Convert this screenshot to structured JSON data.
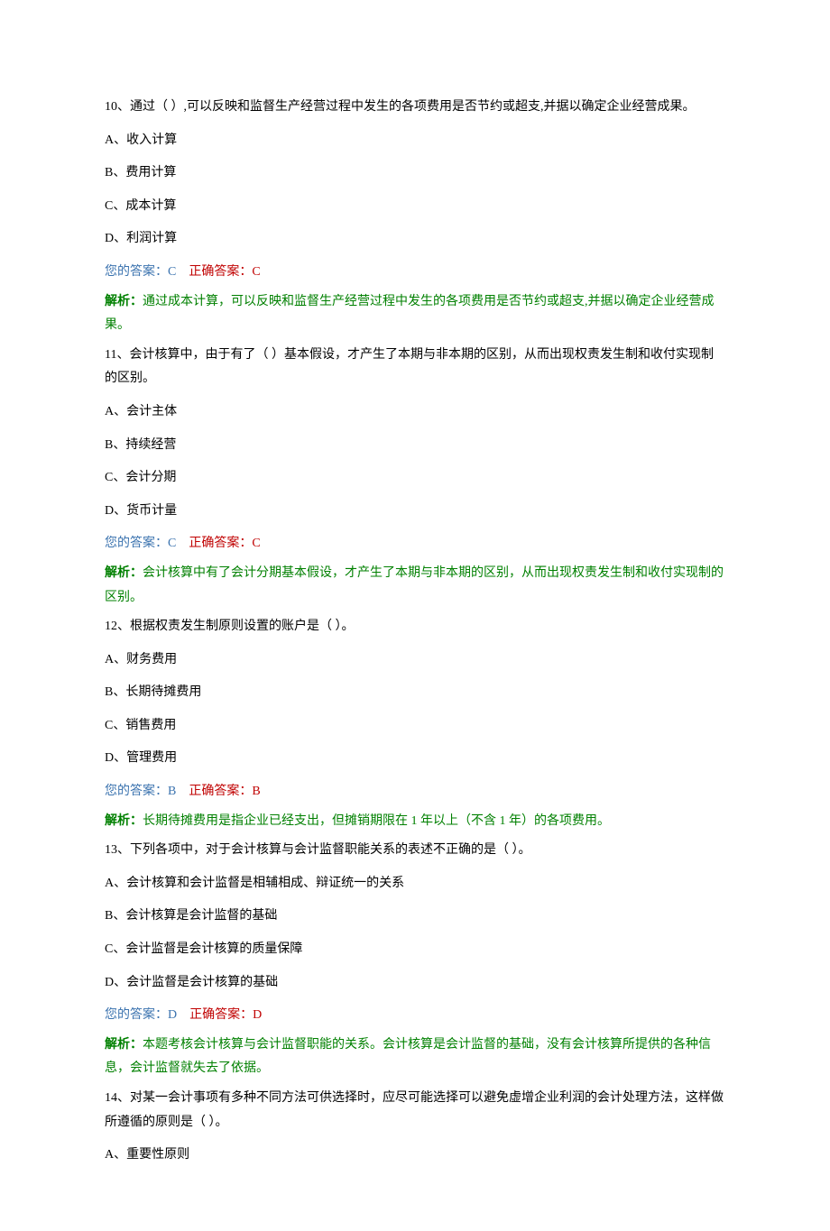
{
  "labels": {
    "your_answer_prefix": "您的答案：",
    "correct_answer_prefix": "正确答案：",
    "analysis_prefix": "解析："
  },
  "questions": [
    {
      "stem": "10、通过（  ）,可以反映和监督生产经营过程中发生的各项费用是否节约或超支,并据以确定企业经营成果。",
      "options": [
        "A、收入计算",
        "B、费用计算",
        "C、成本计算",
        "D、利润计算"
      ],
      "your_answer": "C",
      "correct_answer": "C",
      "analysis": "通过成本计算，可以反映和监督生产经营过程中发生的各项费用是否节约或超支,并据以确定企业经营成果。"
    },
    {
      "stem": "11、会计核算中，由于有了（  ）基本假设，才产生了本期与非本期的区别，从而出现权责发生制和收付实现制的区别。",
      "options": [
        "A、会计主体",
        "B、持续经营",
        "C、会计分期",
        "D、货币计量"
      ],
      "your_answer": "C",
      "correct_answer": "C",
      "analysis": "会计核算中有了会计分期基本假设，才产生了本期与非本期的区别，从而出现权责发生制和收付实现制的区别。"
    },
    {
      "stem": "12、根据权责发生制原则设置的账户是（  ）。",
      "options": [
        "A、财务费用",
        "B、长期待摊费用",
        "C、销售费用",
        "D、管理费用"
      ],
      "your_answer": "B",
      "correct_answer": "B",
      "analysis": "长期待摊费用是指企业已经支出，但摊销期限在 1 年以上（不含 1 年）的各项费用。"
    },
    {
      "stem": "13、下列各项中，对于会计核算与会计监督职能关系的表述不正确的是（  ）。",
      "options": [
        "A、会计核算和会计监督是相辅相成、辩证统一的关系",
        "B、会计核算是会计监督的基础",
        "C、会计监督是会计核算的质量保障",
        "D、会计监督是会计核算的基础"
      ],
      "your_answer": "D",
      "correct_answer": "D",
      "analysis": "本题考核会计核算与会计监督职能的关系。会计核算是会计监督的基础，没有会计核算所提供的各种信息，会计监督就失去了依据。"
    },
    {
      "stem": "14、对某一会计事项有多种不同方法可供选择时，应尽可能选择可以避免虚增企业利润的会计处理方法，这样做所遵循的原则是（  ）。",
      "options": [
        "A、重要性原则"
      ],
      "your_answer": null,
      "correct_answer": null,
      "analysis": null
    }
  ]
}
